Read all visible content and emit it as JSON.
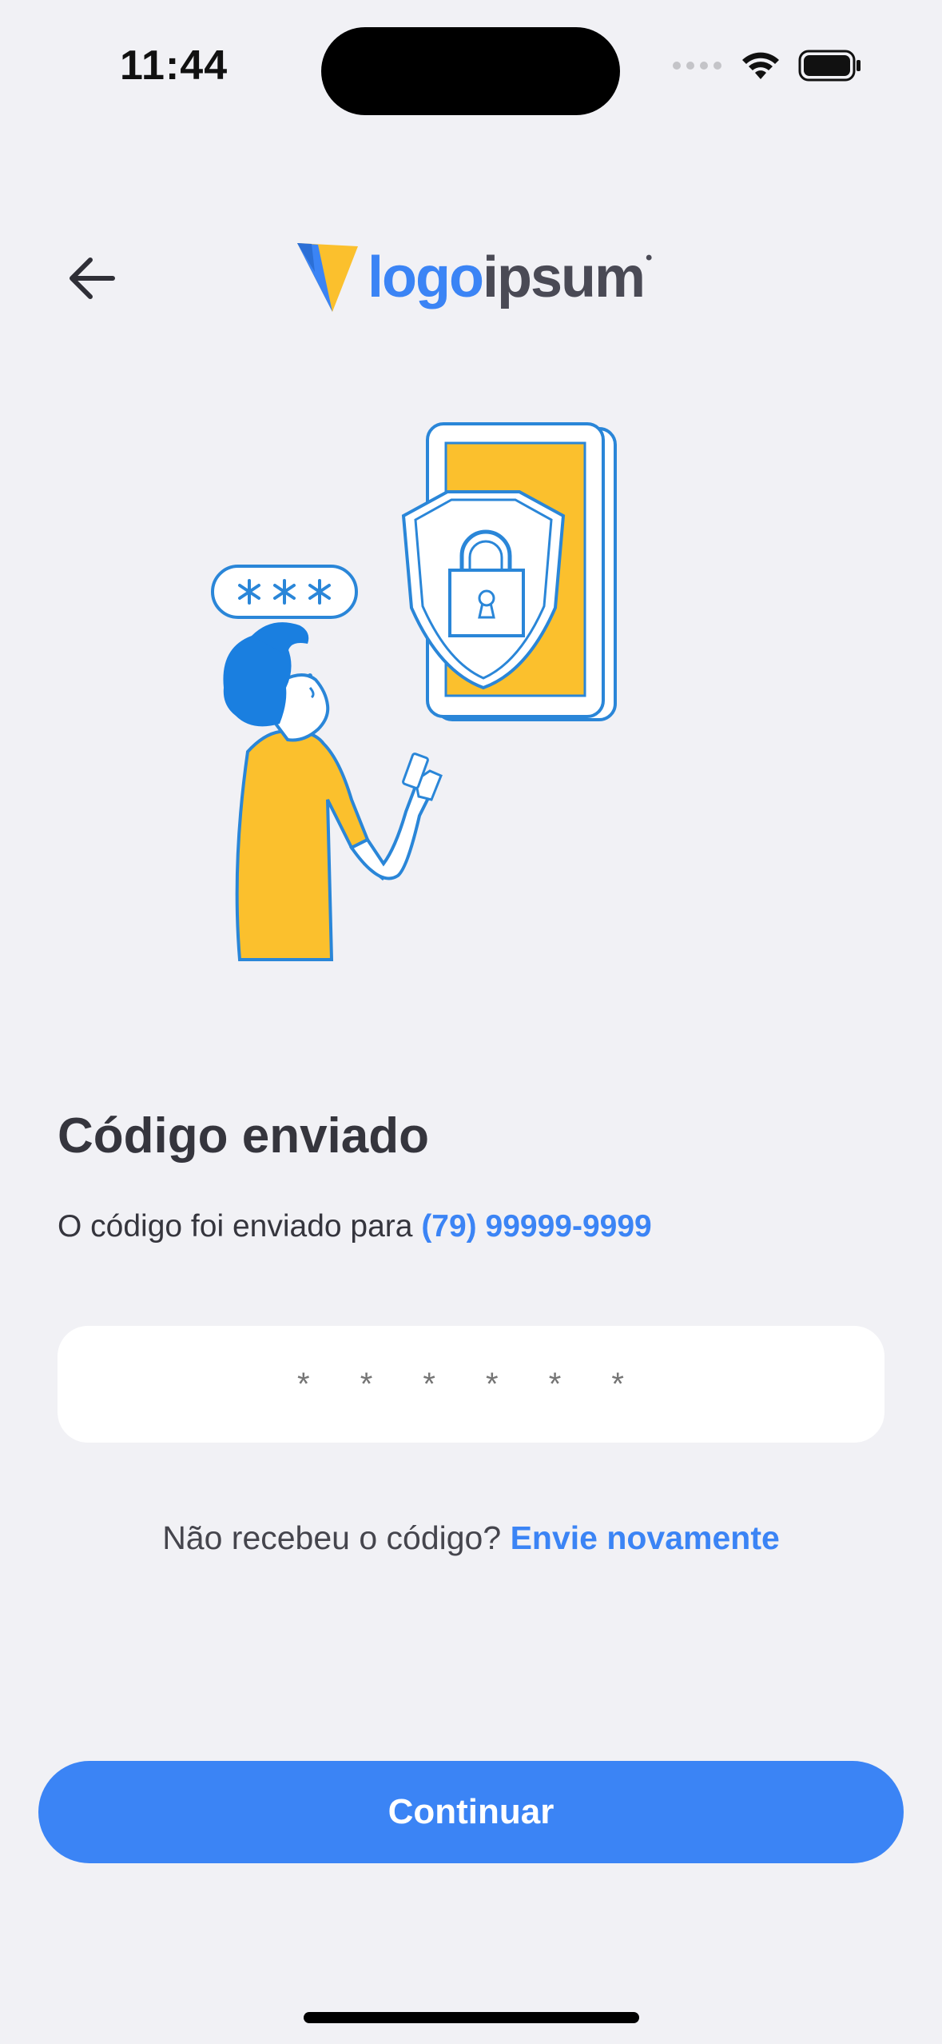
{
  "status_bar": {
    "time": "11:44"
  },
  "header": {
    "back_icon": "arrow-left-icon",
    "brand": {
      "part1": "logo",
      "part2": "ipsum",
      "dot": "•"
    }
  },
  "illustration": {
    "password_mask": "***"
  },
  "main": {
    "title": "Código enviado",
    "subtitle_prefix": "O código foi enviado para ",
    "phone": "(79) 99999-9999",
    "code_placeholder": "* * * * * *",
    "resend_prompt": "Não recebeu o código? ",
    "resend_link": "Envie novamente",
    "continue_label": "Continuar"
  },
  "colors": {
    "accent": "#3b84f5",
    "yellow": "#fbc02d",
    "background": "#f1f1f5"
  }
}
